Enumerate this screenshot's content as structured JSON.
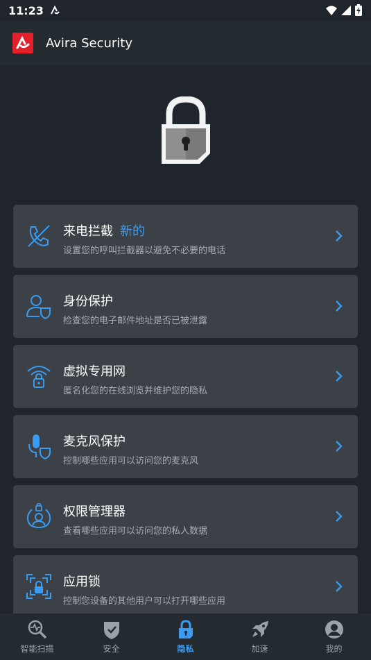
{
  "status": {
    "time": "11:23"
  },
  "app": {
    "title": "Avira Security"
  },
  "cards": [
    {
      "title": "来电拦截",
      "badge": "新的",
      "subtitle": "设置您的呼叫拦截器以避免不必要的电话",
      "icon": "phone-block-icon"
    },
    {
      "title": "身份保护",
      "badge": "",
      "subtitle": "检查您的电子邮件地址是否已被泄露",
      "icon": "identity-shield-icon"
    },
    {
      "title": "虚拟专用网",
      "badge": "",
      "subtitle": "匿名化您的在线浏览并维护您的隐私",
      "icon": "vpn-wifi-lock-icon"
    },
    {
      "title": "麦克风保护",
      "badge": "",
      "subtitle": "控制哪些应用可以访问您的麦克风",
      "icon": "microphone-shield-icon"
    },
    {
      "title": "权限管理器",
      "badge": "",
      "subtitle": "查看哪些应用可以访问您的私人数据",
      "icon": "permission-user-lock-icon"
    },
    {
      "title": "应用锁",
      "badge": "",
      "subtitle": "控制您设备的其他用户可以打开哪些应用",
      "icon": "app-lock-icon"
    }
  ],
  "nav": [
    {
      "label": "智能扫描",
      "icon": "smart-scan-icon",
      "active": false
    },
    {
      "label": "安全",
      "icon": "security-shield-icon",
      "active": false
    },
    {
      "label": "隐私",
      "icon": "privacy-lock-icon",
      "active": true
    },
    {
      "label": "加速",
      "icon": "rocket-icon",
      "active": false
    },
    {
      "label": "我的",
      "icon": "profile-icon",
      "active": false
    }
  ],
  "colors": {
    "accent": "#3a9bf0",
    "brand": "#e3202a",
    "background": "#1f252b",
    "card": "#3b4147"
  }
}
